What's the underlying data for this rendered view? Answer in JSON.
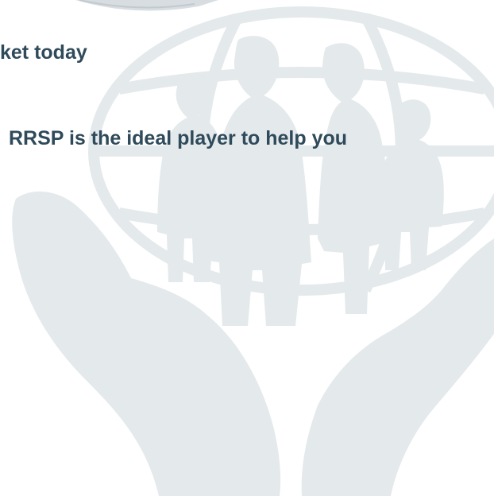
{
  "slide": {
    "line_1": "ket today",
    "line_2": "RRSP is the ideal player to help you"
  },
  "watermark": {
    "icon": "hands-holding-family-globe-icon",
    "color": "#e4e9ec"
  },
  "text_color": "#2f4a5a",
  "background": "#ffffff"
}
